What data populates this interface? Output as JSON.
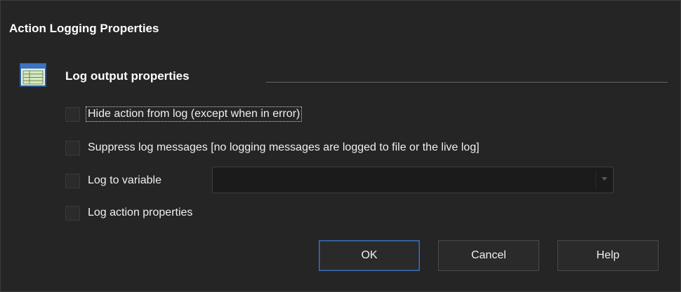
{
  "dialog": {
    "title": "Action Logging Properties"
  },
  "section": {
    "title": "Log output properties",
    "icon": "properties-grid-icon"
  },
  "options": [
    {
      "label": "Hide action from log (except when in error)",
      "checked": false
    },
    {
      "label": "Suppress log messages [no logging messages are logged to file or the live log]",
      "checked": false
    },
    {
      "label": "Log to variable",
      "checked": false
    },
    {
      "label": "Log action properties",
      "checked": false
    }
  ],
  "variable_combo": {
    "value": ""
  },
  "buttons": {
    "ok": "OK",
    "cancel": "Cancel",
    "help": "Help"
  },
  "colors": {
    "background": "#252526",
    "accent": "#3f6fb0"
  }
}
